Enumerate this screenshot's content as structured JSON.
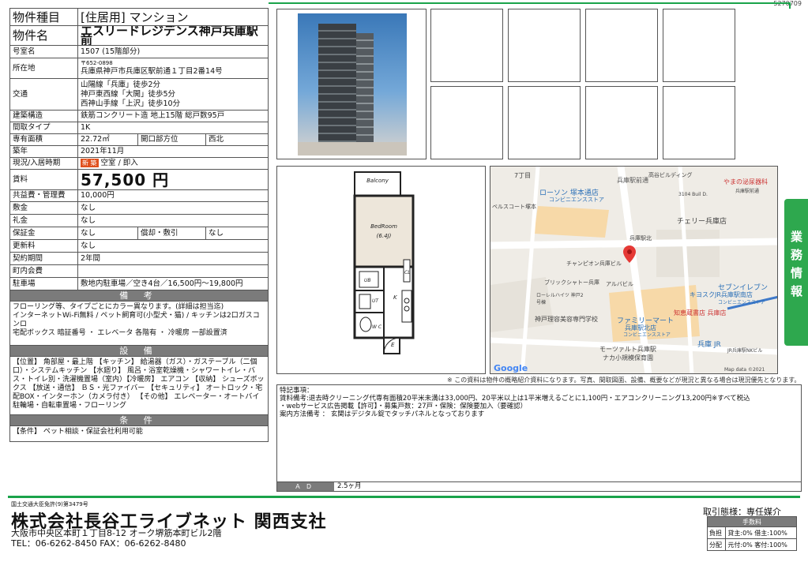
{
  "doc_id": "5270709",
  "spec": {
    "type_k": "物件種目",
    "type_v": "[住居用] マンション",
    "name_k": "物件名",
    "name_v": "エスリードレジデンス神戸兵庫駅前",
    "room_k": "号室名",
    "room_v": "1507 (15階部分)",
    "addr_k": "所在地",
    "addr_zip": "〒652-0898",
    "addr_v": "兵庫県神戸市兵庫区駅前通１丁目2番14号",
    "access_k": "交通",
    "access_1": "山陽線「兵庫」徒歩2分",
    "access_2": "神戸東西線「大開」徒歩5分",
    "access_3": "西神山手線「上沢」徒歩10分",
    "struct_k": "建築構造",
    "struct_v": "鉄筋コンクリート造 地上15階 総戸数95戸",
    "layout_k": "間取タイプ",
    "layout_v": "1K",
    "area_k": "専有面積",
    "area_v": "22.72㎡",
    "dir_k": "開口部方位",
    "dir_v": "西北",
    "built_k": "築年",
    "built_v": "2021年11月",
    "status_k": "現況/入居時期",
    "status_badge": "新 築",
    "status_v": "空室 / 即入",
    "rent_k": "賃料",
    "rent_v": "57,500 円",
    "mgmt_k": "共益費・管理費",
    "mgmt_v": "10,000円",
    "deposit_k": "敷金",
    "deposit_v": "なし",
    "key_k": "礼金",
    "key_v": "なし",
    "guar_k": "保証金",
    "guar_v": "なし",
    "amort_k": "償却・敷引",
    "amort_v": "なし",
    "renew_k": "更新料",
    "renew_v": "なし",
    "term_k": "契約期間",
    "term_v": "2年間",
    "assoc_k": "町内会費",
    "assoc_v": "",
    "parking_k": "駐車場",
    "parking_v": "敷地内駐車場／空き4台／16,500円～19,800円",
    "remarks_h": "備 考",
    "remarks_v": "フローリング等、タイプごとにカラー異なります。(詳細は担当迄)\nインターネットWi-Fi無料 / ペット飼育可(小型犬・猫) / キッチンは2口ガスコンロ\n宅配ボックス 暗証番号 ・ エレベータ 各階有 ・ 冷暖房 一部設置済",
    "equip_h": "設 備",
    "equip_v": "【位置】 角部屋・最上階 【キッチン】 給湯器（ガス）・ガステーブル（二個口）・システムキッチン 【水廻り】 風呂・浴室乾燥機・シャワートイレ・バス・トイレ別・洗濯機置場（室内）【冷暖房】 エアコン 【収納】 シューズボックス 【放送・通信】 ＢＳ・光ファイバー 【セキュリティ】 オートロック・宅配BOX・インターホン（カメラ付き） 【その他】 エレベーター・オートバイ駐輪場・自転車置場・フローリング",
    "cond_h": "条 件",
    "cond_v": "【条件】 ペット相談・保証会社利用可能"
  },
  "plan": {
    "balcony": "Balcony",
    "bedroom": "BedRoom",
    "size": "(6.4J)",
    "ub": "UB",
    "ut": "UT",
    "k": "K",
    "cl": "CL",
    "wc": "W C",
    "e": "E"
  },
  "map": {
    "labels": [
      "7丁目",
      "ローソン 塚本通店",
      "コンビニエンスストア",
      "ベルスコート塚本",
      "兵庫駅前通",
      "高谷ビルディング",
      "やまの泌尿器科",
      "兵庫駅前通",
      "3104 Buil D.",
      "チェリー兵庫店",
      "兵庫駅北",
      "チャンピオン兵庫ビル",
      "ブリックシャトー兵庫",
      "アルバビル",
      "ローレルハイツ 神戸2号棟",
      "神戸理容美容専門学校",
      "ファミリーマート",
      "兵庫駅北店",
      "コンビニエンスストア",
      "セブンイレブン",
      "キヨスクJR兵庫駅南店",
      "コンビニエンスストア",
      "知恵蔵書店 兵庫店",
      "兵庫 JR",
      "JR兵庫駅NKビル",
      "モーツァルト兵庫駅",
      "ナカ小規模保育園",
      "Google",
      "Map data ©2021"
    ]
  },
  "disclaimer": "※ この資料は物件の概略紹介資料になります。写真、間取図面、設備、概要などが現況と異なる場合は現況優先となります。",
  "remarks_box": "特記事項：\n賃料備考:退去時クリーニング代専有面積20平米未満は33,000円、20平米以上は1平米増えるごとに1,100円・エアコンクリーニング13,200円※すべて税込\n・webサービス広告掲載【許可】・募集戸数：27戸・保険：保険要加入（要確認）\n案内方法備考 ： 玄関はデジタル錠でタッチパネルとなっております",
  "ad": {
    "label": "ＡＤ",
    "value": "2.5ヶ月"
  },
  "footer": {
    "license": "国土交通大臣免許(9)第3479号",
    "company": "株式会社長谷工ライブネット 関西支社",
    "address": "大阪市中央区本町１丁目8-12 オーク堺筋本町ビル2階",
    "tel": "TEL：06-6262-8450 FAX：06-6262-8480"
  },
  "deal": {
    "mode": "取引態様：専任媒介",
    "fee_h": "手数料",
    "row1_k": "負担",
    "row1_v": "貸主:0% 借主:100%",
    "row2_k": "分配",
    "row2_v": "元付:0% 客付:100%"
  },
  "side_tab": "業務情報",
  "colors": {
    "accent_green": "#1aa34a",
    "section_gray": "#7b7b7b",
    "new_badge": "#e0501d"
  }
}
